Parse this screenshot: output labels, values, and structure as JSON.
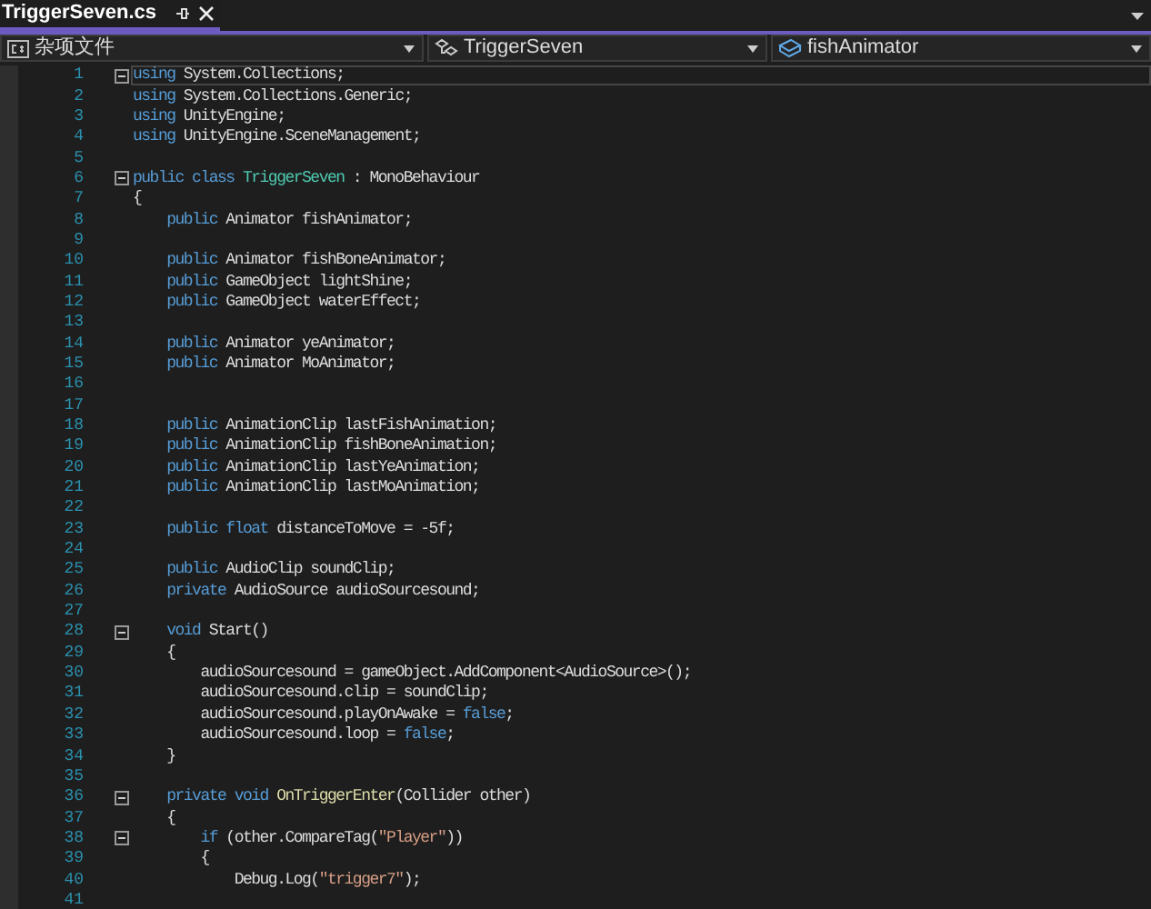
{
  "tab": {
    "title": "TriggerSeven.cs",
    "selected": true
  },
  "navigation": [
    {
      "kind": "project",
      "label": "杂项文件"
    },
    {
      "kind": "class",
      "label": "TriggerSeven"
    },
    {
      "kind": "member",
      "label": "fishAnimator"
    }
  ],
  "lines": [
    {
      "number": "1",
      "foldable": true,
      "current": true,
      "tokens": [
        {
          "kind": "k",
          "text": "using"
        },
        {
          "kind": "p",
          "text": " System.Collections;"
        }
      ]
    },
    {
      "number": "2",
      "foldable": false,
      "current": false,
      "tokens": [
        {
          "kind": "k",
          "text": "using"
        },
        {
          "kind": "p",
          "text": " System.Collections.Generic;"
        }
      ]
    },
    {
      "number": "3",
      "foldable": false,
      "current": false,
      "tokens": [
        {
          "kind": "k",
          "text": "using"
        },
        {
          "kind": "p",
          "text": " UnityEngine;"
        }
      ]
    },
    {
      "number": "4",
      "foldable": false,
      "current": false,
      "tokens": [
        {
          "kind": "k",
          "text": "using"
        },
        {
          "kind": "p",
          "text": " UnityEngine.SceneManagement;"
        }
      ]
    },
    {
      "number": "5",
      "foldable": false,
      "current": false
    },
    {
      "number": "6",
      "foldable": true,
      "current": false,
      "tokens": [
        {
          "kind": "k",
          "text": "public class "
        },
        {
          "kind": "t",
          "text": "TriggerSeven"
        },
        {
          "kind": "p",
          "text": " : MonoBehaviour"
        }
      ]
    },
    {
      "number": "7",
      "foldable": false,
      "current": false,
      "tokens": [
        {
          "kind": "p",
          "text": "{"
        }
      ]
    },
    {
      "number": "8",
      "foldable": false,
      "current": false,
      "tokens": [
        {
          "kind": "k",
          "text": "    public"
        },
        {
          "kind": "p",
          "text": " Animator fishAnimator;"
        }
      ]
    },
    {
      "number": "9",
      "foldable": false,
      "current": false
    },
    {
      "number": "10",
      "foldable": false,
      "current": false,
      "tokens": [
        {
          "kind": "k",
          "text": "    public"
        },
        {
          "kind": "p",
          "text": " Animator fishBoneAnimator;"
        }
      ]
    },
    {
      "number": "11",
      "foldable": false,
      "current": false,
      "tokens": [
        {
          "kind": "k",
          "text": "    public"
        },
        {
          "kind": "p",
          "text": " GameObject lightShine;"
        }
      ]
    },
    {
      "number": "12",
      "foldable": false,
      "current": false,
      "tokens": [
        {
          "kind": "k",
          "text": "    public"
        },
        {
          "kind": "p",
          "text": " GameObject waterEffect;"
        }
      ]
    },
    {
      "number": "13",
      "foldable": false,
      "current": false
    },
    {
      "number": "14",
      "foldable": false,
      "current": false,
      "tokens": [
        {
          "kind": "k",
          "text": "    public"
        },
        {
          "kind": "p",
          "text": " Animator yeAnimator;"
        }
      ]
    },
    {
      "number": "15",
      "foldable": false,
      "current": false,
      "tokens": [
        {
          "kind": "k",
          "text": "    public"
        },
        {
          "kind": "p",
          "text": " Animator MoAnimator;"
        }
      ]
    },
    {
      "number": "16",
      "foldable": false,
      "current": false
    },
    {
      "number": "17",
      "foldable": false,
      "current": false
    },
    {
      "number": "18",
      "foldable": false,
      "current": false,
      "tokens": [
        {
          "kind": "k",
          "text": "    public"
        },
        {
          "kind": "p",
          "text": " AnimationClip lastFishAnimation;"
        }
      ]
    },
    {
      "number": "19",
      "foldable": false,
      "current": false,
      "tokens": [
        {
          "kind": "k",
          "text": "    public"
        },
        {
          "kind": "p",
          "text": " AnimationClip fishBoneAnimation;"
        }
      ]
    },
    {
      "number": "20",
      "foldable": false,
      "current": false,
      "tokens": [
        {
          "kind": "k",
          "text": "    public"
        },
        {
          "kind": "p",
          "text": " AnimationClip lastYeAnimation;"
        }
      ]
    },
    {
      "number": "21",
      "foldable": false,
      "current": false,
      "tokens": [
        {
          "kind": "k",
          "text": "    public"
        },
        {
          "kind": "p",
          "text": " AnimationClip lastMoAnimation;"
        }
      ]
    },
    {
      "number": "22",
      "foldable": false,
      "current": false
    },
    {
      "number": "23",
      "foldable": false,
      "current": false,
      "tokens": [
        {
          "kind": "k",
          "text": "    public float"
        },
        {
          "kind": "p",
          "text": " distanceToMove = -5f;"
        }
      ]
    },
    {
      "number": "24",
      "foldable": false,
      "current": false
    },
    {
      "number": "25",
      "foldable": false,
      "current": false,
      "tokens": [
        {
          "kind": "k",
          "text": "    public"
        },
        {
          "kind": "p",
          "text": " AudioClip soundClip;"
        }
      ]
    },
    {
      "number": "26",
      "foldable": false,
      "current": false,
      "tokens": [
        {
          "kind": "k",
          "text": "    private"
        },
        {
          "kind": "p",
          "text": " AudioSource audioSourcesound;"
        }
      ]
    },
    {
      "number": "27",
      "foldable": false,
      "current": false
    },
    {
      "number": "28",
      "foldable": true,
      "current": false,
      "tokens": [
        {
          "kind": "k",
          "text": "    void"
        },
        {
          "kind": "p",
          "text": " Start()"
        }
      ]
    },
    {
      "number": "29",
      "foldable": false,
      "current": false,
      "tokens": [
        {
          "kind": "p",
          "text": "    {"
        }
      ]
    },
    {
      "number": "30",
      "foldable": false,
      "current": false,
      "tokens": [
        {
          "kind": "p",
          "text": "        audioSourcesound = gameObject.AddComponent<AudioSource>();"
        }
      ]
    },
    {
      "number": "31",
      "foldable": false,
      "current": false,
      "tokens": [
        {
          "kind": "p",
          "text": "        audioSourcesound.clip = soundClip;"
        }
      ]
    },
    {
      "number": "32",
      "foldable": false,
      "current": false,
      "tokens": [
        {
          "kind": "p",
          "text": "        audioSourcesound.playOnAwake = "
        },
        {
          "kind": "k",
          "text": "false"
        },
        {
          "kind": "p",
          "text": ";"
        }
      ]
    },
    {
      "number": "33",
      "foldable": false,
      "current": false,
      "tokens": [
        {
          "kind": "p",
          "text": "        audioSourcesound.loop = "
        },
        {
          "kind": "k",
          "text": "false"
        },
        {
          "kind": "p",
          "text": ";"
        }
      ]
    },
    {
      "number": "34",
      "foldable": false,
      "current": false,
      "tokens": [
        {
          "kind": "p",
          "text": "    }"
        }
      ]
    },
    {
      "number": "35",
      "foldable": false,
      "current": false
    },
    {
      "number": "36",
      "foldable": true,
      "current": false,
      "tokens": [
        {
          "kind": "k",
          "text": "    private void "
        },
        {
          "kind": "m",
          "text": "OnTriggerEnter"
        },
        {
          "kind": "p",
          "text": "(Collider other)"
        }
      ]
    },
    {
      "number": "37",
      "foldable": false,
      "current": false,
      "tokens": [
        {
          "kind": "p",
          "text": "    {"
        }
      ]
    },
    {
      "number": "38",
      "foldable": true,
      "current": false,
      "tokens": [
        {
          "kind": "k",
          "text": "        if"
        },
        {
          "kind": "p",
          "text": " (other.CompareTag("
        },
        {
          "kind": "s",
          "text": "\"Player\""
        },
        {
          "kind": "p",
          "text": "))"
        }
      ]
    },
    {
      "number": "39",
      "foldable": false,
      "current": false,
      "tokens": [
        {
          "kind": "p",
          "text": "        {"
        }
      ]
    },
    {
      "number": "40",
      "foldable": false,
      "current": false,
      "tokens": [
        {
          "kind": "p",
          "text": "            Debug.Log("
        },
        {
          "kind": "s",
          "text": "\"trigger7\""
        },
        {
          "kind": "p",
          "text": ");"
        }
      ]
    },
    {
      "number": "41",
      "foldable": false,
      "current": false
    }
  ]
}
